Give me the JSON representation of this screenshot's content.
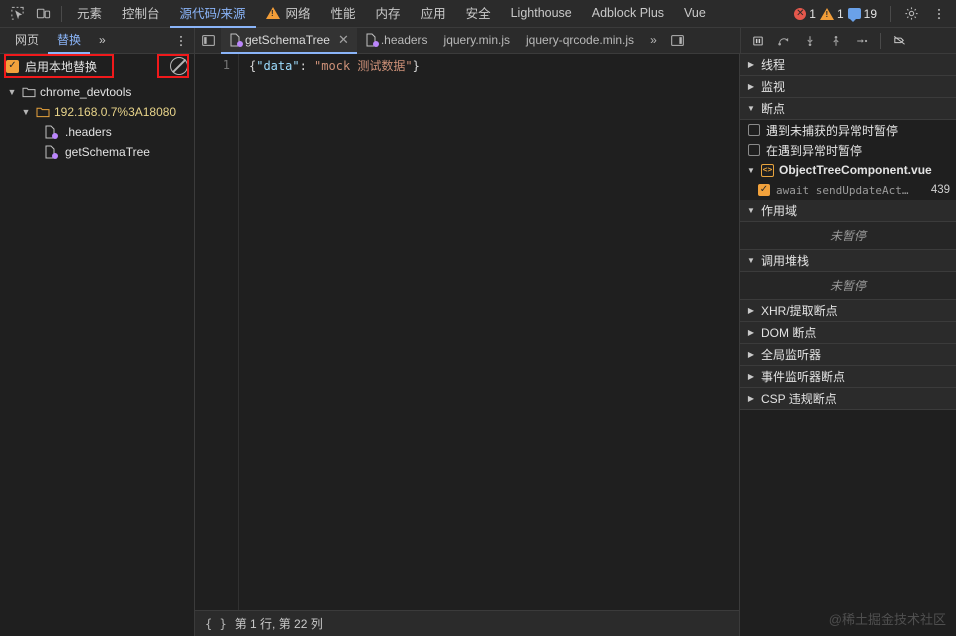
{
  "panel_bar": {
    "inspect_icon": "inspect-element-icon",
    "device_icon": "device-toolbar-icon",
    "tabs": [
      {
        "label": "元素",
        "active": false,
        "warn": false
      },
      {
        "label": "控制台",
        "active": false,
        "warn": false
      },
      {
        "label": "源代码/来源",
        "active": true,
        "warn": false
      },
      {
        "label": "网络",
        "active": false,
        "warn": true
      },
      {
        "label": "性能",
        "active": false,
        "warn": false
      },
      {
        "label": "内存",
        "active": false,
        "warn": false
      },
      {
        "label": "应用",
        "active": false,
        "warn": false
      },
      {
        "label": "安全",
        "active": false,
        "warn": false
      },
      {
        "label": "Lighthouse",
        "active": false,
        "warn": false
      },
      {
        "label": "Adblock Plus",
        "active": false,
        "warn": false
      },
      {
        "label": "Vue",
        "active": false,
        "warn": false
      }
    ],
    "counters": {
      "errors": "1",
      "warnings": "1",
      "infos": "19"
    },
    "settings_icon": "gear-icon",
    "more_icon": "more-vertical-icon"
  },
  "subbar": {
    "nav_tabs": [
      {
        "label": "网页",
        "active": false
      },
      {
        "label": "替换",
        "active": true
      }
    ],
    "nav_more": "»",
    "nav_menu_icon": "more-vertical-icon",
    "sidebar_toggle_icon": "show-navigator-icon",
    "file_tabs": [
      {
        "label": "getSchemaTree",
        "active": true,
        "closable": true
      },
      {
        "label": ".headers",
        "active": false,
        "closable": false
      },
      {
        "label": "jquery.min.js",
        "active": false,
        "closable": false
      },
      {
        "label": "jquery-qrcode.min.js",
        "active": false,
        "closable": false
      }
    ],
    "file_tabs_more": "»",
    "panel_toggle_icon": "show-debugger-icon",
    "debug_controls": [
      {
        "name": "pause-resume-button",
        "glyph": "pause"
      },
      {
        "name": "step-over-button",
        "glyph": "step-over"
      },
      {
        "name": "step-into-button",
        "glyph": "step-into"
      },
      {
        "name": "step-out-button",
        "glyph": "step-out"
      },
      {
        "name": "step-button",
        "glyph": "step"
      },
      {
        "name": "deactivate-breakpoints-button",
        "glyph": "deactivate"
      }
    ]
  },
  "navigator": {
    "enable_override": {
      "label": "启用本地替换",
      "checked": true
    },
    "clear_button_name": "clear-overrides-button",
    "tree": [
      {
        "label": "chrome_devtools",
        "type": "folder",
        "depth": 0,
        "expanded": true
      },
      {
        "label": "192.168.0.7%3A18080",
        "type": "host-folder",
        "depth": 1,
        "expanded": true
      },
      {
        "label": ".headers",
        "type": "file",
        "depth": 2,
        "expanded": false
      },
      {
        "label": "getSchemaTree",
        "type": "file",
        "depth": 2,
        "expanded": false
      }
    ]
  },
  "editor": {
    "line_number": "1",
    "code": {
      "open_brace": "{",
      "key": "\"data\"",
      "colon": ": ",
      "value": "\"mock 测试数据\"",
      "close_brace": "}"
    },
    "status": {
      "format_icon": "{ }",
      "position": "第 1 行, 第 22 列"
    }
  },
  "debugger": {
    "threads": {
      "label": "线程",
      "expanded": false
    },
    "watch": {
      "label": "监视",
      "expanded": false
    },
    "breakpoints": {
      "label": "断点",
      "expanded": true,
      "pause_uncaught": {
        "label": "遇到未捕获的异常时暂停",
        "checked": false
      },
      "pause_exceptions": {
        "label": "在遇到异常时暂停",
        "checked": false
      },
      "files": [
        {
          "name": "ObjectTreeComponent.vue",
          "expanded": true,
          "entries": [
            {
              "snippet": "await sendUpdateAct…",
              "line": "439",
              "checked": true
            }
          ]
        }
      ]
    },
    "scope": {
      "label": "作用域",
      "expanded": true,
      "empty_text": "未暂停"
    },
    "call_stack": {
      "label": "调用堆栈",
      "expanded": true,
      "empty_text": "未暂停"
    },
    "other_sections": [
      {
        "label": "XHR/提取断点",
        "expanded": false
      },
      {
        "label": "DOM 断点",
        "expanded": false
      },
      {
        "label": "全局监听器",
        "expanded": false
      },
      {
        "label": "事件监听器断点",
        "expanded": false
      },
      {
        "label": "CSP 违规断点",
        "expanded": false
      }
    ]
  },
  "watermark": "@稀土掘金技术社区",
  "colors": {
    "accent": "#8ab4f8",
    "background": "#1f1f1f",
    "toolbar": "#2b2b2b",
    "checkbox": "#f2a23c",
    "annotation": "#f0191b",
    "override_dot": "#bb86fc",
    "host_text": "#e8d48a",
    "error": "#e4584c",
    "warning": "#f29d38",
    "info": "#6aa1e8"
  }
}
